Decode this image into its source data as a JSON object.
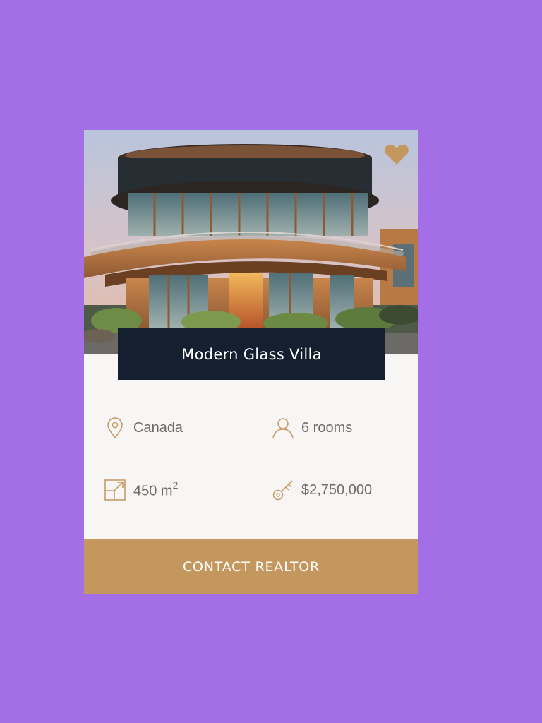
{
  "listing": {
    "title": "Modern Glass Villa",
    "location": "Canada",
    "rooms": "6 rooms",
    "area_value": "450 m",
    "area_unit_power": "2",
    "price": "$2,750,000",
    "favorite": true
  },
  "actions": {
    "contact_label": "CONTACT REALTOR"
  },
  "colors": {
    "page_bg": "#a36ee6",
    "card_bg": "#f7f6f5",
    "title_bg": "#14202f",
    "accent_gold": "#c4975f",
    "text_muted": "#6f6a66"
  },
  "icons": {
    "favorite": "heart-icon",
    "location": "map-pin-icon",
    "rooms": "person-icon",
    "area": "area-expand-icon",
    "price": "key-icon"
  }
}
